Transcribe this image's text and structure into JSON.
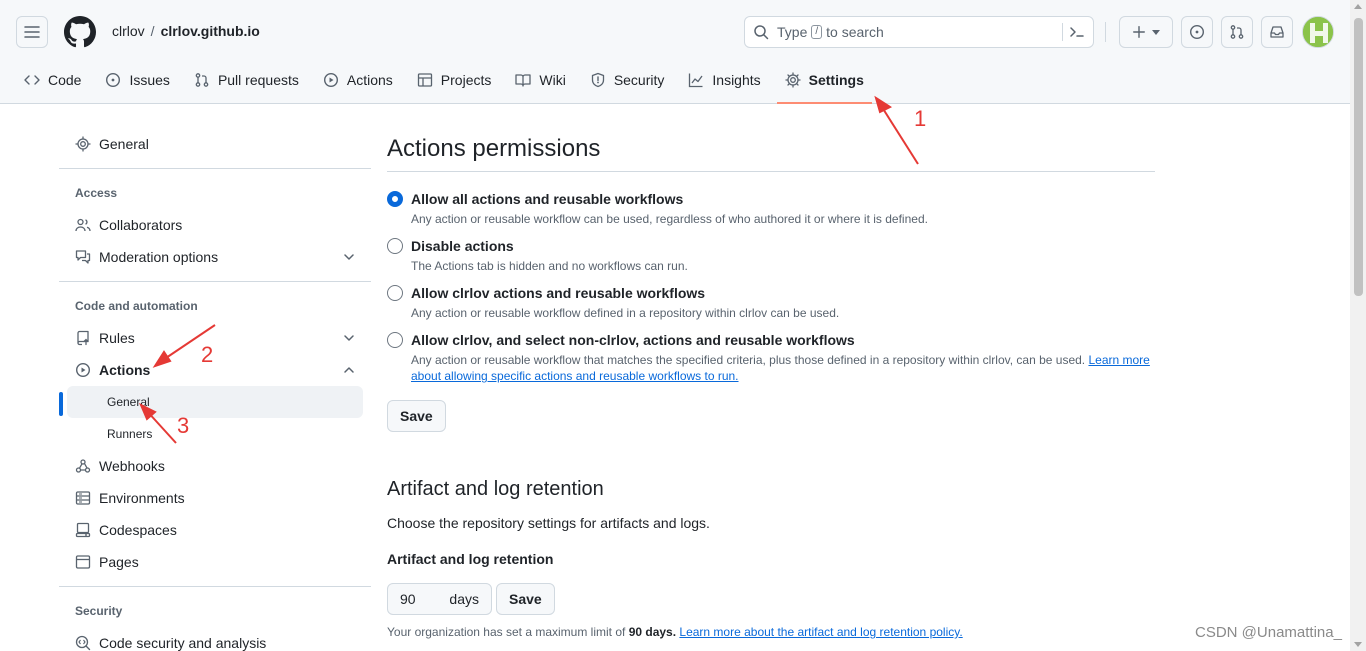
{
  "header": {
    "owner": "clrlov",
    "separator": "/",
    "repo": "clrlov.github.io",
    "search_prefix": "Type",
    "search_key": "/",
    "search_suffix": "to search",
    "avatar_color": "#8bc34a"
  },
  "tabs": [
    {
      "label": "Code",
      "icon": "code-icon"
    },
    {
      "label": "Issues",
      "icon": "issue-icon"
    },
    {
      "label": "Pull requests",
      "icon": "pull-request-icon"
    },
    {
      "label": "Actions",
      "icon": "play-icon"
    },
    {
      "label": "Projects",
      "icon": "table-icon"
    },
    {
      "label": "Wiki",
      "icon": "book-icon"
    },
    {
      "label": "Security",
      "icon": "shield-icon"
    },
    {
      "label": "Insights",
      "icon": "graph-icon"
    },
    {
      "label": "Settings",
      "icon": "gear-icon",
      "selected": true
    }
  ],
  "sidebar": {
    "general": "General",
    "access_heading": "Access",
    "collaborators": "Collaborators",
    "moderation": "Moderation options",
    "code_heading": "Code and automation",
    "rules": "Rules",
    "actions": "Actions",
    "actions_general": "General",
    "runners": "Runners",
    "webhooks": "Webhooks",
    "environments": "Environments",
    "codespaces": "Codespaces",
    "pages": "Pages",
    "security_heading": "Security",
    "code_security": "Code security and analysis"
  },
  "main": {
    "permissions_title": "Actions permissions",
    "options": [
      {
        "label": "Allow all actions and reusable workflows",
        "note": "Any action or reusable workflow can be used, regardless of who authored it or where it is defined.",
        "checked": true
      },
      {
        "label": "Disable actions",
        "note": "The Actions tab is hidden and no workflows can run.",
        "checked": false
      },
      {
        "label": "Allow clrlov actions and reusable workflows",
        "note": "Any action or reusable workflow defined in a repository within clrlov can be used.",
        "checked": false
      },
      {
        "label": "Allow clrlov, and select non-clrlov, actions and reusable workflows",
        "note": "Any action or reusable workflow that matches the specified criteria, plus those defined in a repository within clrlov, can be used.",
        "link": "Learn more about allowing specific actions and reusable workflows to run.",
        "checked": false
      }
    ],
    "save_label": "Save",
    "retention_title": "Artifact and log retention",
    "retention_desc": "Choose the repository settings for artifacts and logs.",
    "retention_label": "Artifact and log retention",
    "retention_value": "90",
    "retention_unit": "days",
    "retention_save": "Save",
    "retention_note_prefix": "Your organization has set a maximum limit of",
    "retention_note_limit": "90 days.",
    "retention_note_link": "Learn more about the artifact and log retention policy."
  },
  "annotations": {
    "one": "1",
    "two": "2",
    "three": "3",
    "color": "#e53935"
  },
  "watermark": "CSDN @Unamattina_"
}
